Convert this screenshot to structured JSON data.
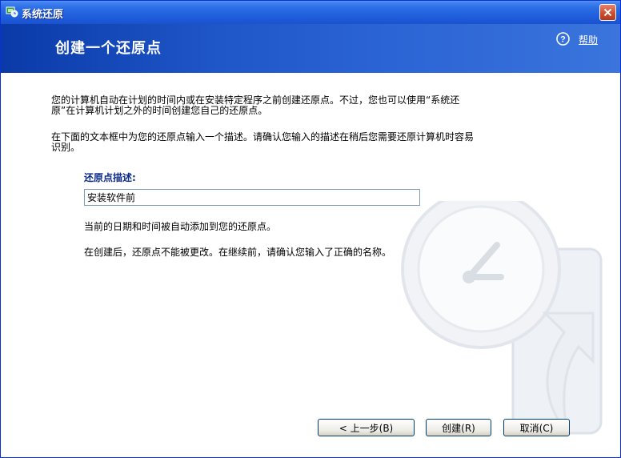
{
  "window": {
    "title": "系统还原",
    "colors": {
      "titlebar": "#2c6ee6",
      "header": "#1f56c8",
      "close": "#c94a2b",
      "label": "#0b2a8a"
    }
  },
  "header": {
    "title": "创建一个还原点",
    "help_label": "帮助"
  },
  "content": {
    "intro_line1": "您的计算机自动在计划的时间内或在安装特定程序之前创建还原点。不过，您也可以使用“系统还",
    "intro_line2": "原”在计算机计划之外的时间创建您自己的还原点。",
    "instruction_line1": "在下面的文本框中为您的还原点输入一个描述。请确认您输入的描述在稍后您需要还原计算机时容易",
    "instruction_line2": "识别。",
    "field_label": "还原点描述:",
    "field_value": "安装软件前",
    "note_datetime": "当前的日期和时间被自动添加到您的还原点。",
    "note_warning": "在创建后，还原点不能被更改。在继续前，请确认您输入了正确的名称。"
  },
  "buttons": {
    "back": "< 上一步(B)",
    "create": "创建(R)",
    "cancel": "取消(C)"
  },
  "icons": {
    "title": "system-restore-icon",
    "close": "close-icon",
    "help": "help-icon",
    "background": "clock-restore-graphic"
  }
}
